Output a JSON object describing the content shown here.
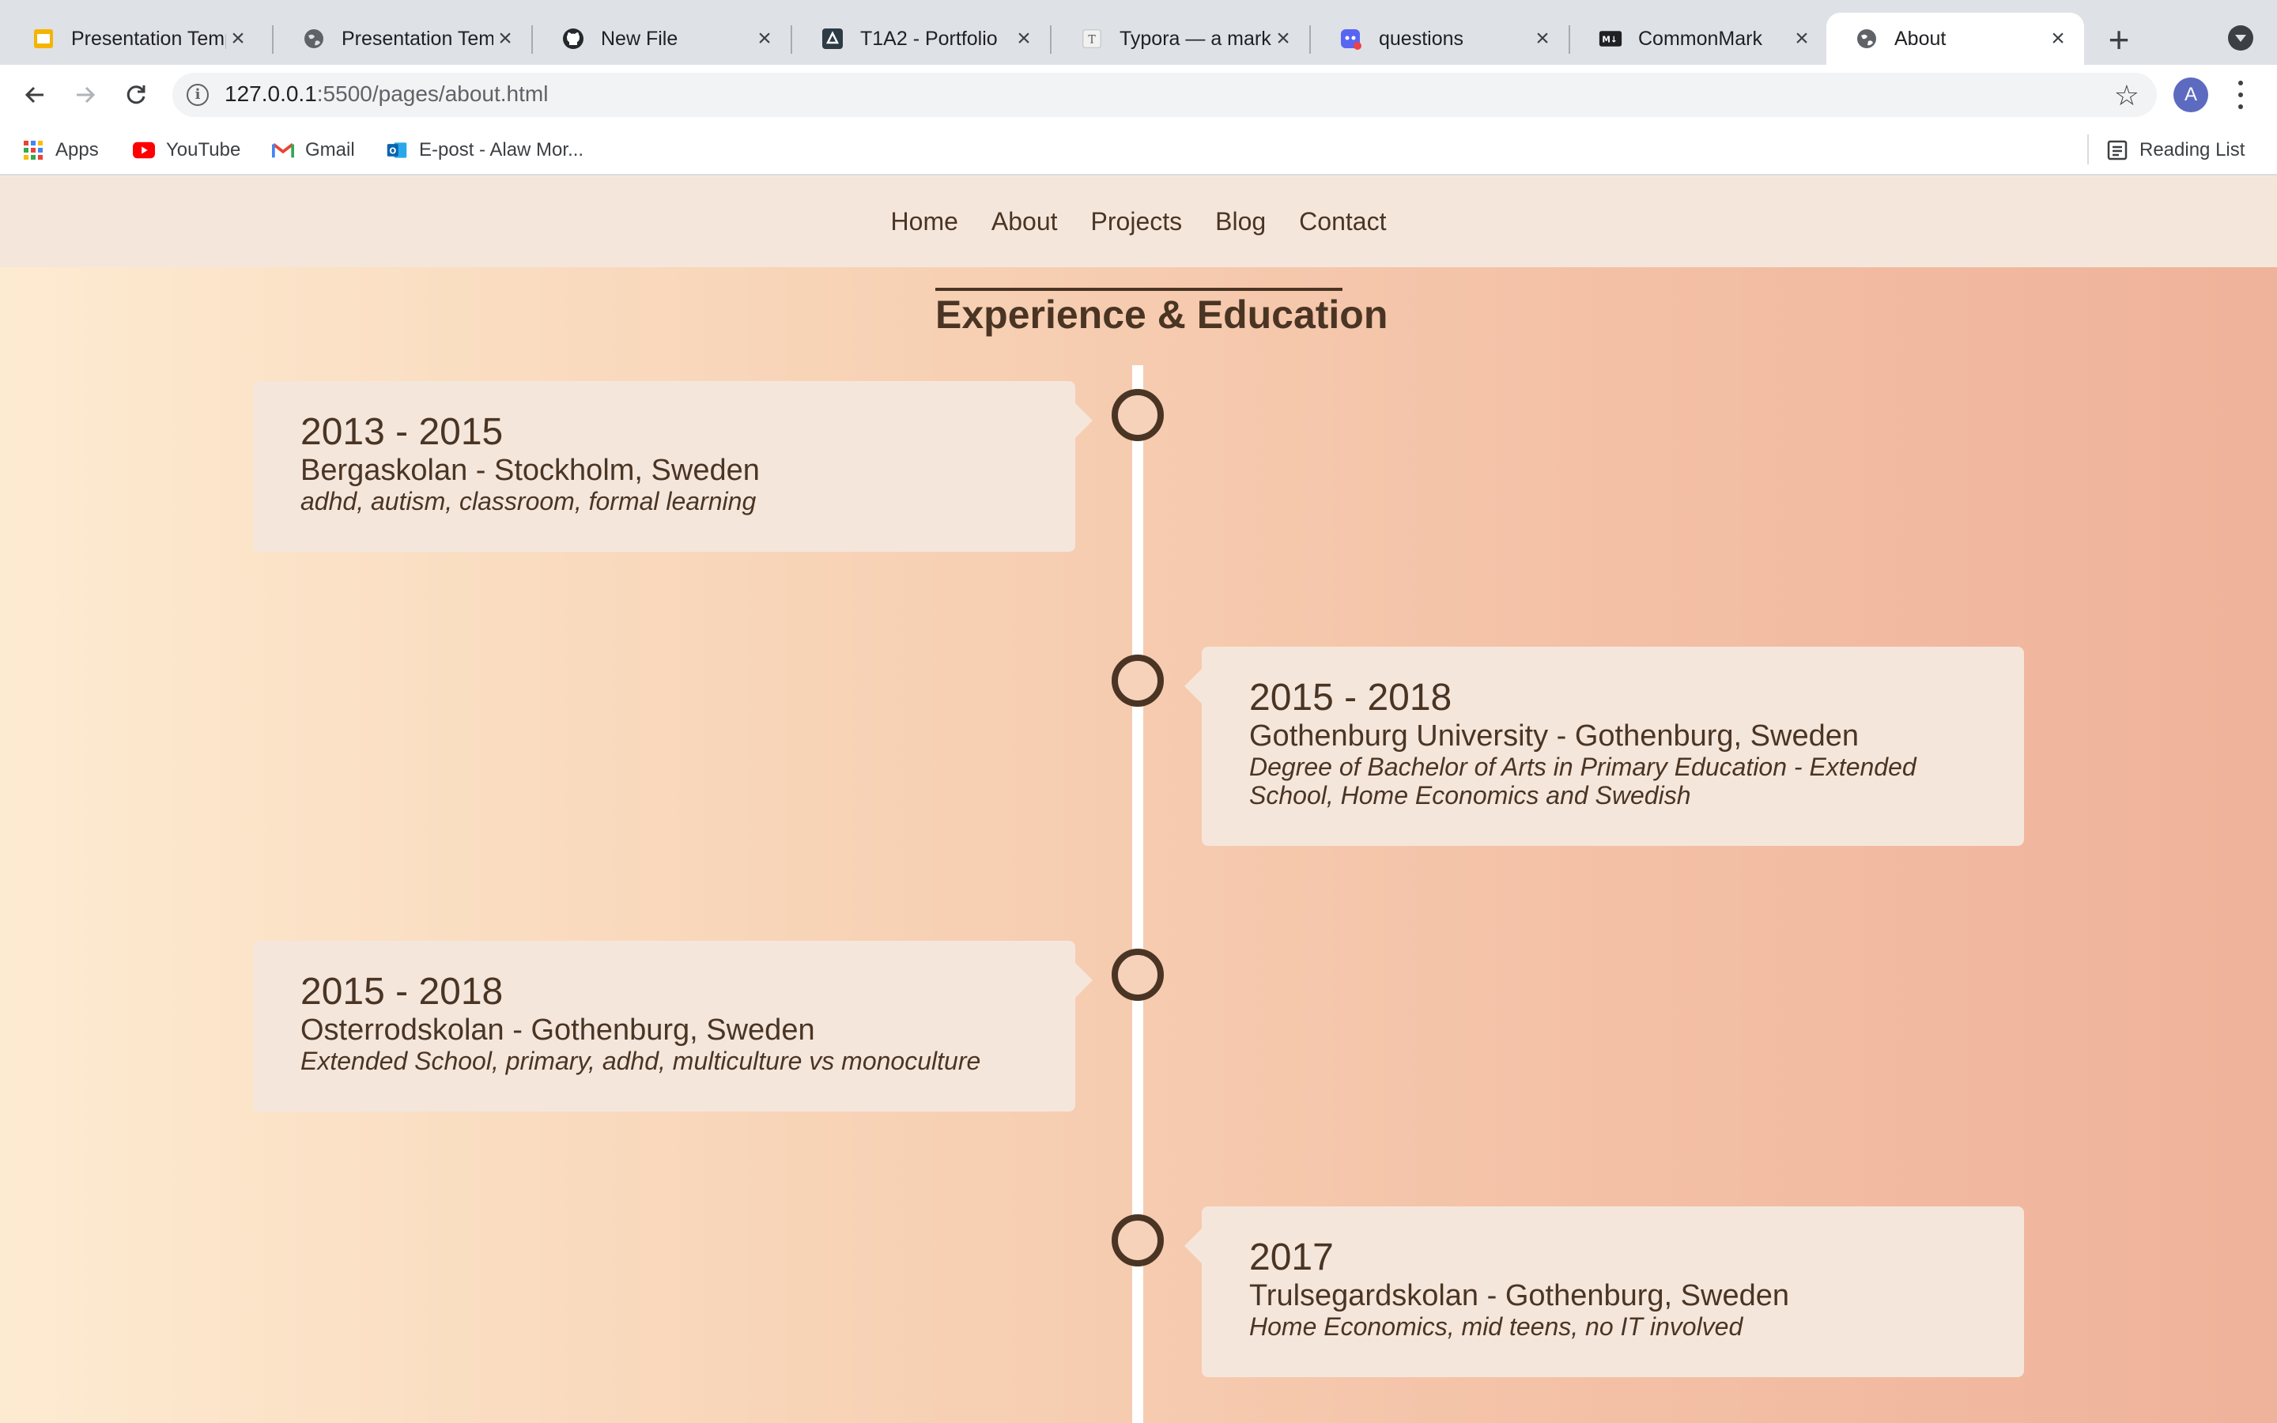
{
  "browser": {
    "tabs": [
      {
        "title": "Presentation Templ",
        "icon": "slides-icon",
        "active": false
      },
      {
        "title": "Presentation Temp",
        "icon": "globe-icon",
        "active": false
      },
      {
        "title": "New File",
        "icon": "github-icon",
        "active": false
      },
      {
        "title": "T1A2 - Portfolio",
        "icon": "canvas-icon",
        "active": false
      },
      {
        "title": "Typora — a markd",
        "icon": "typora-icon",
        "active": false
      },
      {
        "title": "questions",
        "icon": "discord-icon",
        "active": false
      },
      {
        "title": "CommonMark",
        "icon": "markdown-icon",
        "active": false
      },
      {
        "title": "About",
        "icon": "globe-icon",
        "active": true
      }
    ],
    "address": {
      "host": "127.0.0.1",
      "path": ":5500/pages/about.html"
    },
    "profile_initial": "A",
    "bookmarks": [
      {
        "label": "Apps",
        "icon": "apps-grid-icon"
      },
      {
        "label": "YouTube",
        "icon": "youtube-icon"
      },
      {
        "label": "Gmail",
        "icon": "gmail-icon"
      },
      {
        "label": "E-post - Alaw Mor...",
        "icon": "outlook-icon"
      }
    ],
    "reading_list": "Reading List"
  },
  "site": {
    "nav": [
      "Home",
      "About",
      "Projects",
      "Blog",
      "Contact"
    ],
    "section_title": "Experience & Education",
    "timeline": [
      {
        "years": "2013 - 2015",
        "place": "Bergaskolan - Stockholm, Sweden",
        "tags": "adhd, autism, classroom, formal learning",
        "side": "left"
      },
      {
        "years": "2015 - 2018",
        "place": "Gothenburg University - Gothenburg, Sweden",
        "tags": "Degree of Bachelor of Arts in Primary Education - Extended School, Home Economics and Swedish",
        "side": "right"
      },
      {
        "years": "2015 - 2018",
        "place": "Osterrodskolan - Gothenburg, Sweden",
        "tags": "Extended School, primary, adhd, multiculture vs monoculture",
        "side": "left"
      },
      {
        "years": "2017",
        "place": "Trulsegardskolan - Gothenburg, Sweden",
        "tags": "Home Economics, mid teens, no IT involved",
        "side": "right"
      }
    ]
  },
  "colors": {
    "text_brown": "#4a3524",
    "card_bg": "#f5e6dc",
    "gradient_left": "#fdebd1",
    "gradient_right": "#efb29a"
  }
}
